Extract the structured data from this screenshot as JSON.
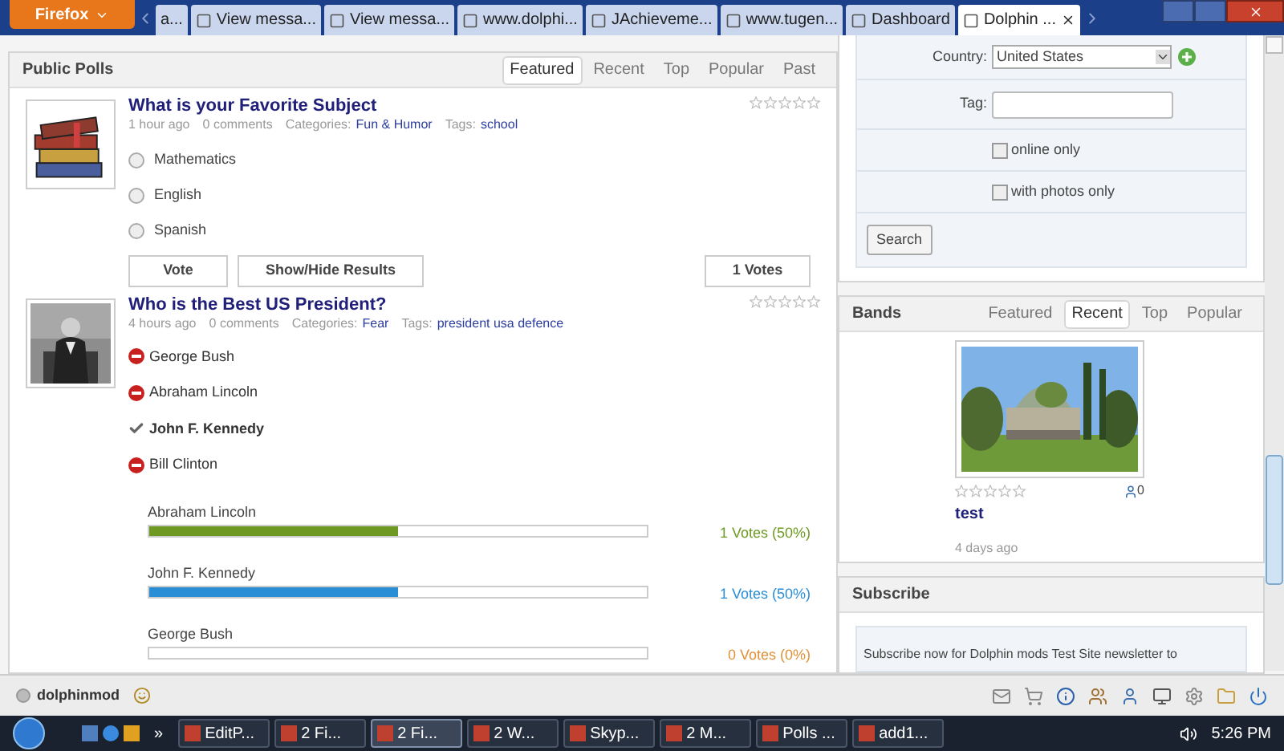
{
  "browser": {
    "menu_button": "Firefox",
    "tabs": [
      {
        "label": "a...",
        "selected": false
      },
      {
        "label": "View messa...",
        "selected": false
      },
      {
        "label": "View messa...",
        "selected": false
      },
      {
        "label": "www.dolphi...",
        "selected": false
      },
      {
        "label": "JAchieveme...",
        "selected": false
      },
      {
        "label": "www.tugen...",
        "selected": false
      },
      {
        "label": "Dashboard",
        "selected": false
      },
      {
        "label": "Dolphin ...",
        "selected": true
      }
    ]
  },
  "polls": {
    "title": "Public Polls",
    "tabs": [
      {
        "label": "Featured",
        "selected": true
      },
      {
        "label": "Recent",
        "selected": false
      },
      {
        "label": "Top",
        "selected": false
      },
      {
        "label": "Popular",
        "selected": false
      },
      {
        "label": "Past",
        "selected": false
      }
    ],
    "items": [
      {
        "kind": "open",
        "title": "What is your Favorite Subject",
        "time": "1 hour ago",
        "comments": "0 comments",
        "categories_label": "Categories:",
        "category": "Fun & Humor",
        "tags_label": "Tags:",
        "tags": "school",
        "stars": 0,
        "options": [
          {
            "label": "Mathematics",
            "checked": false
          },
          {
            "label": "English",
            "checked": false
          },
          {
            "label": "Spanish",
            "checked": false
          }
        ],
        "buttons": [
          "Vote",
          "Show/Hide Results"
        ],
        "votes": "1 Votes"
      },
      {
        "kind": "voted",
        "title": "Who is the Best US President?",
        "time": "4 hours ago",
        "comments": "0 comments",
        "categories_label": "Categories:",
        "category": "Fear",
        "tags_label": "Tags:",
        "tags": "president usa defence",
        "stars": 0,
        "options": [
          {
            "label": "George Bush",
            "selected": false
          },
          {
            "label": "Abraham Lincoln",
            "selected": false
          },
          {
            "label": "John F. Kennedy",
            "selected": true
          },
          {
            "label": "Bill Clinton",
            "selected": false
          }
        ],
        "results": [
          {
            "label": "Abraham Lincoln",
            "level": 0.5,
            "reading": "1 Votes (50%)",
            "color": "#6e9a23"
          },
          {
            "label": "John F. Kennedy",
            "level": 0.5,
            "reading": "1 Votes (50%)",
            "color": "#2a8ed6"
          },
          {
            "label": "George Bush",
            "reading": "0 Votes (0%)",
            "color": "#e0913a"
          }
        ]
      }
    ]
  },
  "search": {
    "country_label": "Country:",
    "country": "United States",
    "tag_label": "Tag:",
    "checkboxes": [
      {
        "label": "online only",
        "checked": false
      },
      {
        "label": "with photos only",
        "checked": false
      }
    ],
    "button": "Search"
  },
  "bands": {
    "title": "Bands",
    "tabs": [
      {
        "label": "Featured",
        "selected": false
      },
      {
        "label": "Recent",
        "selected": true
      },
      {
        "label": "Top",
        "selected": false
      },
      {
        "label": "Popular",
        "selected": false
      }
    ],
    "item": {
      "stars": 0,
      "fans": "0",
      "title": "test",
      "time": "4 days ago"
    }
  },
  "subscribe": {
    "title": "Subscribe",
    "text": "Subscribe now for Dolphin mods Test Site newsletter to"
  },
  "chat_bar": {
    "user": "dolphinmod",
    "online": false
  },
  "taskbar": {
    "more": "»",
    "items": [
      {
        "label": "EditP...",
        "selected": false
      },
      {
        "label": "2 Fi...",
        "selected": false
      },
      {
        "label": "2 Fi...",
        "selected": true
      },
      {
        "label": "2 W...",
        "selected": false
      },
      {
        "label": "Skyp...",
        "selected": false
      },
      {
        "label": "2 M...",
        "selected": false
      },
      {
        "label": "Polls ...",
        "selected": false
      },
      {
        "label": "add1...",
        "selected": false
      }
    ],
    "clock": "5:26 PM"
  }
}
